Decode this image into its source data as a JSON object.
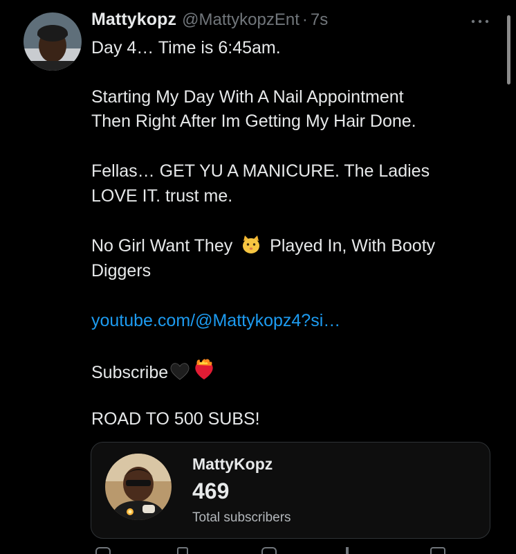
{
  "tweet": {
    "display_name": "Mattykopz",
    "handle": "@MattykopzEnt",
    "separator": "·",
    "time": "7s",
    "lines": {
      "l1": "Day 4… Time is 6:45am.",
      "l2": "Starting My Day With A Nail Appointment",
      "l3": "Then Right After Im Getting My Hair Done.",
      "l4": "Fellas… GET YU A MANICURE. The Ladies",
      "l5": "LOVE IT. trust me.",
      "l6a": "No Girl Want They",
      "l6b": "Played In, With Booty",
      "l7": "Diggers",
      "link": "youtube.com/@Mattykopz4?si…",
      "l9": "Subscribe",
      "l10": "ROAD TO 500 SUBS!"
    },
    "emojis": [
      "cat-face-emoji",
      "black-heart-emoji",
      "heart-on-fire-emoji"
    ]
  },
  "card": {
    "channel_name": "MattyKopz",
    "subscriber_count": "469",
    "subscriber_label": "Total subscribers"
  },
  "icons": [
    "more-icon",
    "profile-avatar",
    "channel-avatar"
  ],
  "colors": {
    "background": "#000000",
    "text": "#e7e9ea",
    "secondary": "#71767b",
    "link": "#1d9bf0",
    "card_border": "#2f3336"
  }
}
